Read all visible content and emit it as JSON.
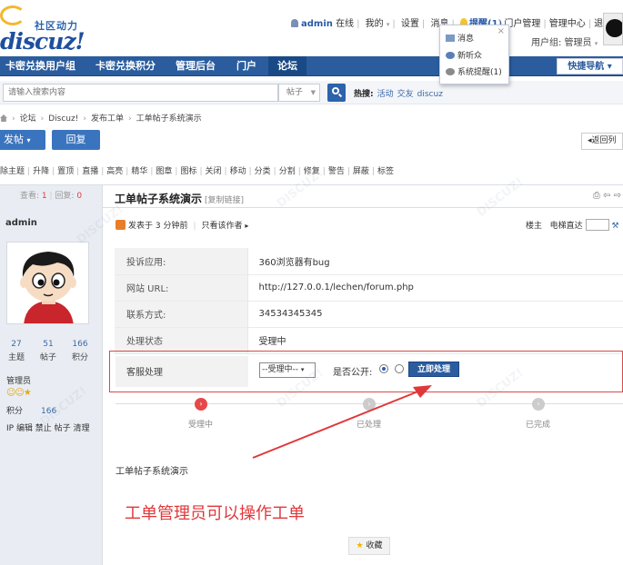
{
  "header": {
    "logo_cn": "社区动力",
    "logo_en": "discuz!",
    "username": "admin",
    "online_status": "在线",
    "links": [
      "我的",
      "设置",
      "消息"
    ],
    "remind_label": "提醒(1)",
    "admin_links": [
      "门户管理",
      "管理中心",
      "退出"
    ],
    "usergroup_label": "用户组: 管理员"
  },
  "reminder_popup": {
    "items": [
      "消息",
      "新听众",
      "系统提醒(1)"
    ]
  },
  "nav": {
    "items": [
      "卡密兑换用户组",
      "卡密兑换积分",
      "管理后台",
      "门户",
      "论坛"
    ],
    "quick_nav": "快捷导航"
  },
  "search": {
    "placeholder": "请输入搜索内容",
    "type": "帖子",
    "hot_label": "热搜:",
    "hot_terms": [
      "活动",
      "交友",
      "discuz"
    ]
  },
  "breadcrumb": [
    "论坛",
    "Discuz!",
    "发布工单",
    "工单帖子系统演示"
  ],
  "buttons": {
    "post": "发帖",
    "reply": "回复",
    "back": "返回列"
  },
  "mod_actions": [
    "除主题",
    "升降",
    "置顶",
    "直播",
    "高亮",
    "精华",
    "图章",
    "图标",
    "关闭",
    "移动",
    "分类",
    "分割",
    "修复",
    "警告",
    "屏蔽",
    "标签"
  ],
  "thread": {
    "views_label": "查看:",
    "views": "1",
    "replies_label": "回复:",
    "replies": "0",
    "title": "工单帖子系统演示",
    "copy_link": "[复制链接]"
  },
  "author": {
    "name": "admin",
    "stats": [
      {
        "num": "27",
        "label": "主题"
      },
      {
        "num": "51",
        "label": "帖子"
      },
      {
        "num": "166",
        "label": "积分"
      }
    ],
    "role": "管理员",
    "credit_label": "积分",
    "credit_value": "166",
    "admin_links": "IP 编辑 禁止 帖子 清理"
  },
  "post_meta": {
    "posted": "发表于 3 分钟前",
    "only_author": "只看该作者",
    "floor": "楼主",
    "jump_label": "电梯直达"
  },
  "ticket": {
    "rows": [
      {
        "label": "投诉应用:",
        "value": "360浏览器有bug"
      },
      {
        "label": "网站 URL:",
        "value": "http://127.0.0.1/lechen/forum.php"
      },
      {
        "label": "联系方式:",
        "value": "34534345345"
      },
      {
        "label": "处理状态",
        "value": "受理中"
      }
    ],
    "service_label": "客服处理",
    "status_select": "--受理中--",
    "public_label": "是否公开:",
    "process_button": "立即处理"
  },
  "steps": [
    "受理中",
    "已处理",
    "已完成"
  ],
  "post_body": "工单帖子系统演示",
  "note": "工单管理员可以操作工单",
  "favorite": "收藏",
  "colors": {
    "nav_blue": "#2b5d9e",
    "accent_red": "#e0383a",
    "link_blue": "#3b69a7"
  }
}
